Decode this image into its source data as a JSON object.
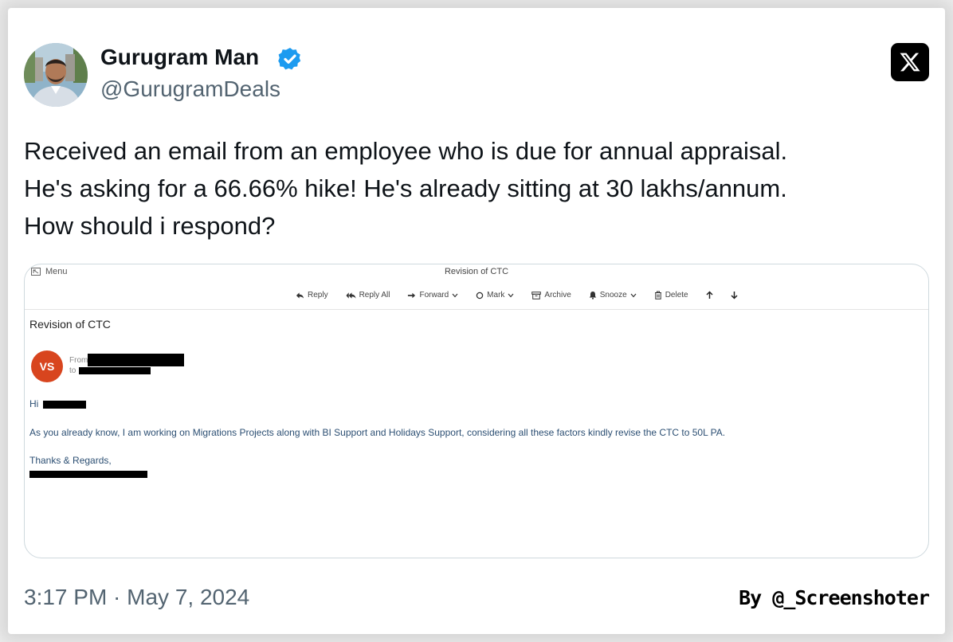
{
  "tweet": {
    "author_name": "Gurugram Man",
    "handle": "@GurugramDeals",
    "verified": true,
    "text_lines": [
      "Received an email from an employee who is due for annual appraisal.",
      "He's asking for a 66.66% hike! He's already sitting at 30 lakhs/annum.",
      "How should i respond?"
    ],
    "timestamp": "3:17 PM · May 7, 2024",
    "platform_icon": "x-logo-icon"
  },
  "email": {
    "menu_label": "Menu",
    "window_title": "Revision of CTC",
    "toolbar": [
      {
        "label": "Reply",
        "icon": "reply-icon"
      },
      {
        "label": "Reply All",
        "icon": "reply-all-icon"
      },
      {
        "label": "Forward",
        "icon": "forward-icon",
        "dropdown": true
      },
      {
        "label": "Mark",
        "icon": "mark-circle-icon",
        "dropdown": true
      },
      {
        "label": "Archive",
        "icon": "archive-icon"
      },
      {
        "label": "Snooze",
        "icon": "bell-icon",
        "dropdown": true
      },
      {
        "label": "Delete",
        "icon": "trash-icon"
      }
    ],
    "subject": "Revision of CTC",
    "sender_initials": "VS",
    "from_label": "From",
    "to_label": "to",
    "greeting": "Hi",
    "body": "As you already know, I am working on Migrations Projects along with BI Support and Holidays Support, considering all these factors kindly revise the CTC to 50L PA.",
    "signoff": "Thanks & Regards,",
    "accent_color": "#d8451e",
    "body_color": "#2c4f73"
  },
  "credit": "By @_Screenshoter",
  "colors": {
    "verified_blue": "#1d9bf0",
    "secondary_text": "#536471",
    "primary_text": "#0f1419"
  }
}
